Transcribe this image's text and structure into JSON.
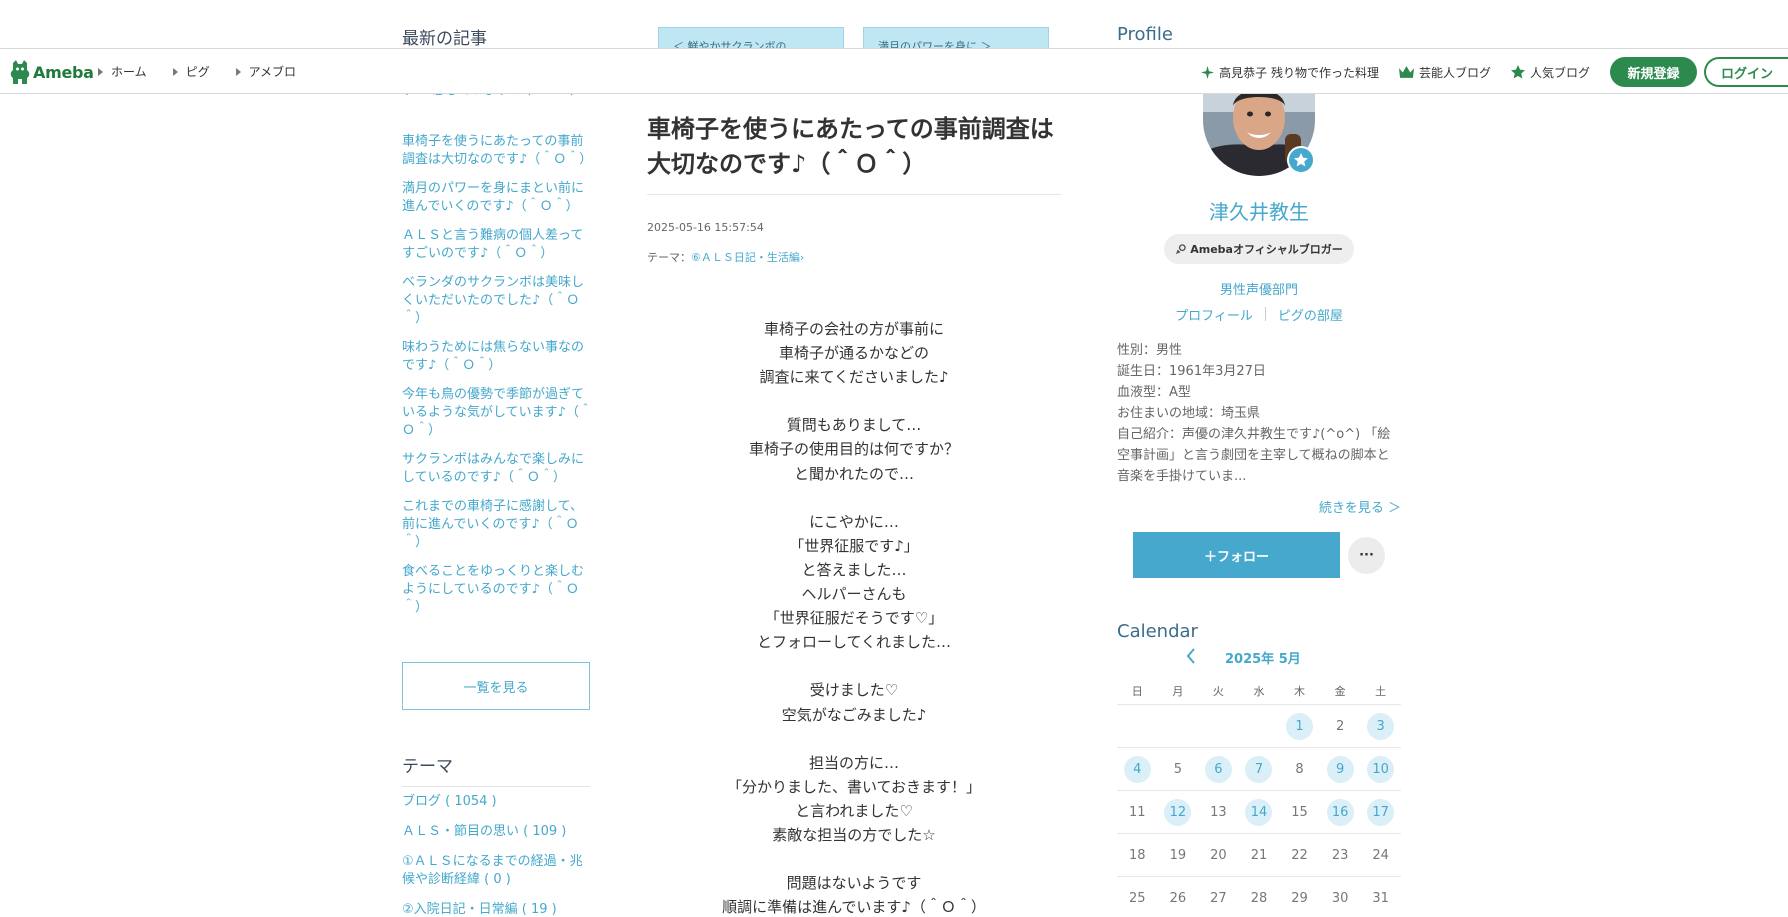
{
  "header": {
    "logo_text": "Ameba",
    "breadcrumbs": [
      "ホーム",
      "ピグ",
      "アメブロ"
    ],
    "links": [
      {
        "icon": "sparkle-icon",
        "label": "高見恭子 残り物で作った料理"
      },
      {
        "icon": "crown-icon",
        "label": "芸能人ブログ"
      },
      {
        "icon": "star-icon",
        "label": "人気ブログ"
      }
    ],
    "register_label": "新規登録",
    "login_label": "ログイン",
    "accent_color": "#2d8a4e"
  },
  "sidebar": {
    "latest_title": "最新の記事",
    "cut_text": "す～ 恋しています♪（＾Ｏ＾）",
    "articles": [
      "車椅子を使うにあたっての事前調査は大切なのです♪（＾Ｏ＾）",
      "満月のパワーを身にまとい前に進んでいくのです♪（＾Ｏ＾）",
      "ＡＬＳと言う難病の個人差ってすごいのです♪（＾Ｏ＾）",
      "ベランダのサクランボは美味しくいただいたのでした♪（＾Ｏ＾）",
      "味わうためには焦らない事なのです♪（＾Ｏ＾）",
      "今年も鳥の優勢で季節が過ぎているような気がしています♪（＾Ｏ＾）",
      "サクランボはみんなで楽しみにしているのです♪（＾Ｏ＾）",
      "これまでの車椅子に感謝して、前に進んでいくのです♪（＾Ｏ＾）",
      "食べることをゆっくりと楽しむようにしているのです♪（＾Ｏ＾）"
    ],
    "list_button": "一覧を見る",
    "theme_title": "テーマ",
    "themes": [
      "ブログ ( 1054 )",
      "ＡＬＳ・節目の思い ( 109 )",
      "①ＡＬＳになるまでの経過・兆候や診断経緯 ( 0 )",
      "②入院日記・日常編 ( 19 )"
    ]
  },
  "nav": {
    "prev_label": "＜ 鮮やかサクランボの",
    "next_label": "満月のパワーを身に ＞"
  },
  "post": {
    "title": "車椅子を使うにあたっての事前調査は大切なのです♪（＾Ｏ＾）",
    "date": "2025-05-16 15:57:54",
    "theme_prefix": "テーマ：",
    "theme_label": "⑥ＡＬＳ日記・生活編",
    "body": [
      "車椅子の会社の方が事前に",
      "車椅子が通るかなどの",
      "調査に来てくださいました♪",
      "",
      "質問もありまして…",
      "車椅子の使用目的は何ですか？",
      "と聞かれたので…",
      "",
      "にこやかに…",
      "「世界征服です♪」",
      "と答えました…",
      "ヘルパーさんも",
      "「世界征服だそうです♡」",
      "とフォローしてくれました…",
      "",
      "受けました♡",
      "空気がなごみました♪",
      "",
      "担当の方に…",
      "「分かりました、書いておきます！」",
      "と言われました♡",
      "素敵な担当の方でした☆",
      "",
      "問題はないようです",
      "順調に準備は進んでいます♪（＾Ｏ＾）"
    ]
  },
  "profile": {
    "title": "Profile",
    "name": "津久井教生",
    "official_label": "Amebaオフィシャルブロガー",
    "category": "男性声優部門",
    "link_profile": "プロフィール",
    "link_pig": "ピグの部屋",
    "info": [
      "性別：男性",
      "誕生日：1961年3月27日",
      "血液型：A型",
      "お住まいの地域：埼玉県",
      "自己紹介：声優の津久井教生です♪(^o^) 「絵空事計画」と言う劇団を主宰して概ねの脚本と音楽を手掛けていま..."
    ],
    "more_label": "続きを見る ＞",
    "follow_label": "＋フォロー",
    "dots_label": "···"
  },
  "calendar": {
    "title": "Calendar",
    "month": "2025年 5月",
    "weekdays": [
      "日",
      "月",
      "火",
      "水",
      "木",
      "金",
      "土"
    ],
    "weeks": [
      [
        {
          "d": ""
        },
        {
          "d": ""
        },
        {
          "d": ""
        },
        {
          "d": ""
        },
        {
          "d": "1",
          "on": true
        },
        {
          "d": "2"
        },
        {
          "d": "3",
          "on": true
        }
      ],
      [
        {
          "d": "4",
          "on": true
        },
        {
          "d": "5"
        },
        {
          "d": "6",
          "on": true
        },
        {
          "d": "7",
          "on": true
        },
        {
          "d": "8"
        },
        {
          "d": "9",
          "on": true
        },
        {
          "d": "10",
          "on": true
        }
      ],
      [
        {
          "d": "11"
        },
        {
          "d": "12",
          "on": true
        },
        {
          "d": "13"
        },
        {
          "d": "14",
          "on": true
        },
        {
          "d": "15"
        },
        {
          "d": "16",
          "on": true
        },
        {
          "d": "17",
          "on": true
        }
      ],
      [
        {
          "d": "18"
        },
        {
          "d": "19"
        },
        {
          "d": "20"
        },
        {
          "d": "21"
        },
        {
          "d": "22"
        },
        {
          "d": "23"
        },
        {
          "d": "24"
        }
      ],
      [
        {
          "d": "25"
        },
        {
          "d": "26"
        },
        {
          "d": "27"
        },
        {
          "d": "28"
        },
        {
          "d": "29"
        },
        {
          "d": "30"
        },
        {
          "d": "31"
        }
      ]
    ],
    "accent_color": "#45a8cc"
  }
}
